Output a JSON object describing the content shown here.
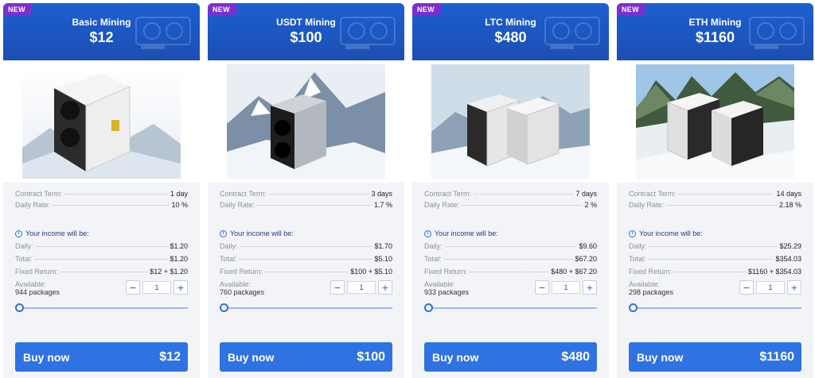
{
  "badge": "NEW",
  "buy_label": "Buy now",
  "terms_labels": {
    "contract_term": "Contract Term:",
    "daily_rate": "Daily Rate:"
  },
  "income_labels": {
    "title": "Your income will be:",
    "daily": "Daily:",
    "total": "Total:",
    "fixed_return": "Fixed Return:",
    "available": "Available:"
  },
  "colors": {
    "header": "#1d5fd1",
    "badge": "#7a2fcf",
    "buy_button": "#2f73e3",
    "card_bg": "#f3f4f8"
  },
  "icons": {
    "info": "info-circle-icon",
    "minus": "minus-icon",
    "plus": "plus-icon"
  },
  "plans": [
    {
      "name": "Basic Mining",
      "price": "$12",
      "contract_term": "1 day",
      "daily_rate": "10 %",
      "daily_income": "$1.20",
      "total_income": "$1.20",
      "fixed_return": "$12 + $1.20",
      "available": "944 packages",
      "quantity": "1",
      "buy_price": "$12"
    },
    {
      "name": "USDT Mining",
      "price": "$100",
      "contract_term": "3 days",
      "daily_rate": "1.7 %",
      "daily_income": "$1.70",
      "total_income": "$5.10",
      "fixed_return": "$100 + $5.10",
      "available": "760 packages",
      "quantity": "1",
      "buy_price": "$100"
    },
    {
      "name": "LTC Mining",
      "price": "$480",
      "contract_term": "7 days",
      "daily_rate": "2 %",
      "daily_income": "$9.60",
      "total_income": "$67.20",
      "fixed_return": "$480 + $67.20",
      "available": "933 packages",
      "quantity": "1",
      "buy_price": "$480"
    },
    {
      "name": "ETH Mining",
      "price": "$1160",
      "contract_term": "14 days",
      "daily_rate": "2.18 %",
      "daily_income": "$25.29",
      "total_income": "$354.03",
      "fixed_return": "$1160 + $354.03",
      "available": "298 packages",
      "quantity": "1",
      "buy_price": "$1160"
    }
  ]
}
